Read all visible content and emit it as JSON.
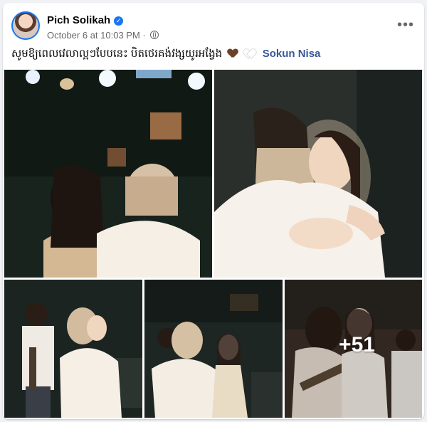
{
  "post": {
    "author": "Pich Solikah",
    "timestamp": "October 6 at 10:03 PM",
    "separator": "·",
    "caption": "សូមឱ្យពេលវេលាល្អៗបែបនេះ បិតថេរគង់វង្សយូរអង្វែង",
    "mention": "Sokun Nisa",
    "more_photos_label": "+51"
  },
  "icons": {
    "verified": "verified-check-icon",
    "audience": "globe-icon",
    "more": "more-options-icon",
    "heart_1": "brown-heart-emoji",
    "heart_2": "white-heart-emoji"
  },
  "colors": {
    "page_bg": "#f0f2f5",
    "card_bg": "#ffffff",
    "link": "#385898",
    "verified": "#1877f2",
    "meta_text": "#65676b"
  }
}
